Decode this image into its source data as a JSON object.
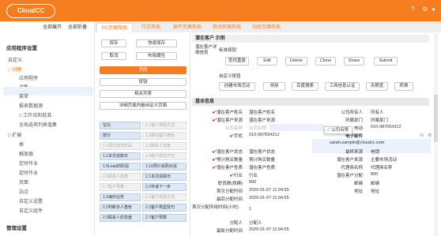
{
  "app": {
    "logo": "CloudCC"
  },
  "sidebar": {
    "title": "应用程序设置",
    "items": [
      "自定义",
      "□ 创建",
      "应用程序",
      "对象",
      "菜单",
      "报表数据源",
      "□ 工作流和批准",
      "全局选项列表值集",
      "□ 扩展",
      "类",
      "触发器",
      "定时作业",
      "定时作业",
      "页面",
      "站点",
      "自定义设置",
      "自定义组件"
    ],
    "footer_title": "管理设置"
  },
  "toplinks": {
    "expand": "全部展开",
    "collapse": "全部折叠"
  },
  "tabs": [
    "PC页面布局",
    "行式布局",
    "扁平页面布局",
    "移动页面布局",
    "动态页面布局"
  ],
  "palette": {
    "save": "保存",
    "quick_save": "快速保存",
    "cancel": "取消",
    "layout_props": "布局属性",
    "field_header": "字段",
    "buttons": "按钮",
    "related": "相关列表",
    "detail_custom": "详细页面内嵌自定义页面",
    "fields": [
      [
        "空白",
        "1.1客户类型方式"
      ],
      [
        "部分",
        "1.2移动客户角色"
      ],
      [
        "1.1预计成交阶段",
        "1.3联系人态度"
      ],
      [
        "1.1本次追踪日",
        "1.4客户成交方式"
      ],
      [
        "1.5Lead的阶段",
        "1.10预计采购对话"
      ],
      [
        "1.6联系人态度",
        "2.1本次追踪日"
      ],
      [
        "1.7客户预算",
        "2.2传递下一步"
      ],
      [
        "1.9海外业务",
        "2.1客户类型方式"
      ],
      [
        "2.2判断本人角色",
        "2.3客户类型技巧"
      ],
      [
        "2.3联系人的态度",
        "2.7客户预算"
      ]
    ]
  },
  "canvas": {
    "title": "潜在客户 示例",
    "detail_label": "潜在客户详细信息",
    "std_buttons_label": "标准按钮",
    "std_buttons": [
      "查找重复",
      "Edit",
      "Delete",
      "Clone",
      "Share",
      "Submit"
    ],
    "custom_buttons_label": "自定义按钮",
    "custom_buttons": [
      "创建市场活动",
      "领用",
      "百度搜索",
      "工商信息认证",
      "天眼查",
      "转换"
    ],
    "basic_info": "基本信息",
    "left_rows": [
      [
        "*潜在客户姓名",
        "潜在客户姓名"
      ],
      [
        "*潜在客户来源",
        "潜在客户来源"
      ],
      [
        "公司名称",
        "公司名称"
      ],
      [
        "*手机",
        "010-987654312"
      ],
      [
        "",
        ""
      ],
      [
        "*潜在客户状态",
        "潜在客户状态"
      ],
      [
        "*预计购买数量",
        "预计购买数量"
      ],
      [
        "*潜在客户性质",
        "潜在客户性质"
      ],
      [
        "*行业",
        "行业"
      ],
      [
        "职员数(规模)",
        "890"
      ],
      [
        "首次分配时间",
        "2020-01-07 11:04:55"
      ],
      [
        "最后分配时间",
        "2020-01-07 11:04:55"
      ],
      [
        "首次分配所用时间(小时)",
        "1"
      ],
      [
        "分配人",
        "分配人"
      ],
      [
        "最新分配时间",
        "2020-01-07 11:04:55"
      ]
    ],
    "right_rows": [
      [
        "公司所有人",
        "所有人"
      ],
      [
        "所属部门",
        "所属部门"
      ],
      [
        "电话",
        "010-987654312"
      ],
      [
        "电子邮件",
        "sarah.sample@cloudcc.com"
      ],
      [
        "",
        ""
      ],
      [
        "最终来源",
        "电销"
      ],
      [
        "潜在客户来源",
        "主要市场活动"
      ],
      [
        "代理商名称",
        "代理商名称"
      ],
      [
        "潜在客户分配",
        "890"
      ],
      [
        "邮编",
        "邮编"
      ],
      [
        "地址",
        "地址"
      ]
    ],
    "popup": "公司名称"
  },
  "colors": {
    "brand": "#f57c1f",
    "field_bg": "#dde8f6"
  }
}
